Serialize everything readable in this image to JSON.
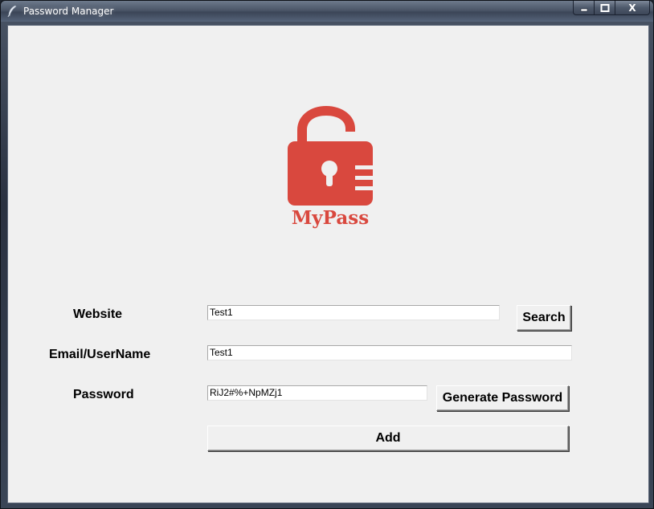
{
  "window": {
    "title": "Password Manager",
    "controls": {
      "minimize": "–",
      "maximize": "□",
      "close": "X"
    }
  },
  "logo": {
    "text": "MyPass",
    "color": "#d9483e"
  },
  "form": {
    "website_label": "Website",
    "website_value": "Test1",
    "search_label": "Search",
    "email_label": "Email/UserName",
    "email_value": "Test1",
    "password_label": "Password",
    "password_value": "RiJ2#%+NpMZj1",
    "generate_label": "Generate Password",
    "add_label": "Add"
  }
}
